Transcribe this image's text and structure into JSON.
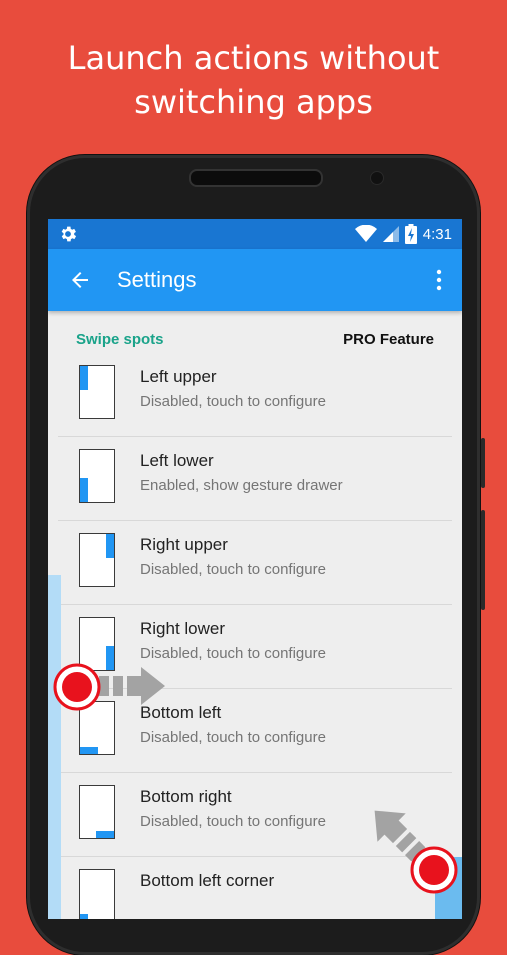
{
  "headline": {
    "line1": "Launch actions without",
    "line2": "switching apps"
  },
  "status_bar": {
    "time": "4:31",
    "icons": [
      "settings-gear-icon",
      "wifi-icon",
      "signal-icon",
      "battery-charging-icon"
    ]
  },
  "app_bar": {
    "title": "Settings",
    "back_icon": "arrow-back-icon",
    "menu_icon": "more-vert-icon"
  },
  "section": {
    "title": "Swipe spots",
    "badge": "PRO Feature"
  },
  "items": [
    {
      "title": "Left upper",
      "subtitle": "Disabled, touch to configure",
      "spot": "left-upper"
    },
    {
      "title": "Left lower",
      "subtitle": "Enabled, show gesture drawer",
      "spot": "left-lower"
    },
    {
      "title": "Right upper",
      "subtitle": "Disabled, touch to configure",
      "spot": "right-upper"
    },
    {
      "title": "Right lower",
      "subtitle": "Disabled, touch to configure",
      "spot": "right-lower"
    },
    {
      "title": "Bottom left",
      "subtitle": "Disabled, touch to configure",
      "spot": "bottom-left"
    },
    {
      "title": "Bottom right",
      "subtitle": "Disabled, touch to configure",
      "spot": "bottom-right"
    },
    {
      "title": "Bottom left corner",
      "subtitle": "",
      "spot": "bottom-left-corner"
    }
  ],
  "colors": {
    "background": "#e84c3d",
    "status_bar": "#1976d2",
    "app_bar": "#2196f3",
    "section_title": "#1aa38a",
    "spot": "#2196f3",
    "touch_marker": "#e8121d"
  }
}
